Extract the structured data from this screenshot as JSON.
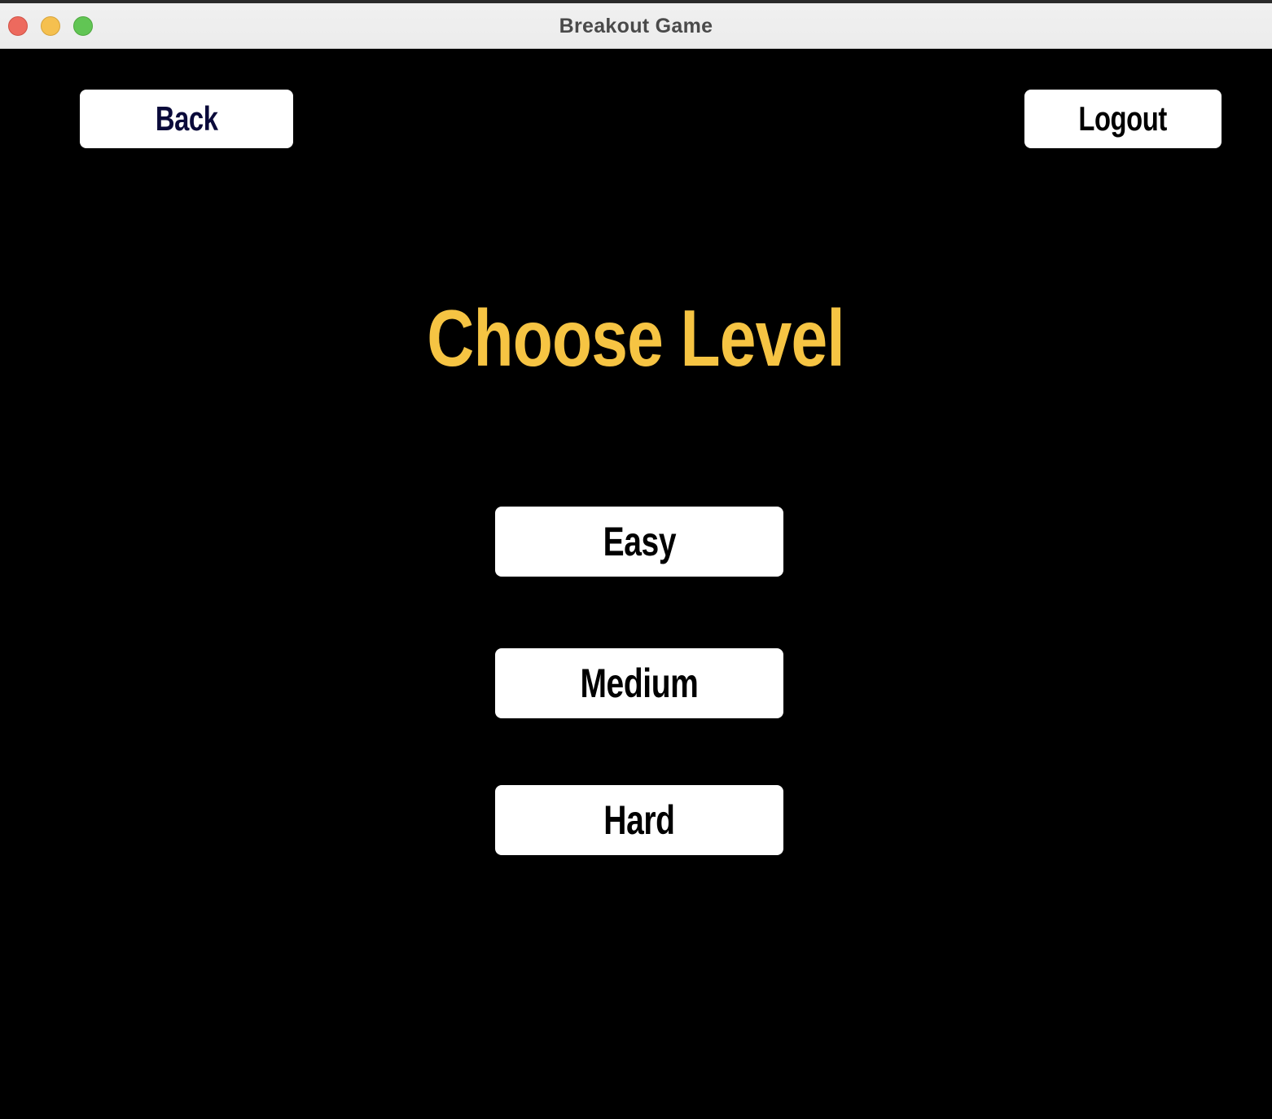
{
  "window": {
    "title": "Breakout Game"
  },
  "toolbar": {
    "back_label": "Back",
    "logout_label": "Logout"
  },
  "main": {
    "heading": "Choose Level",
    "levels": [
      {
        "label": "Easy"
      },
      {
        "label": "Medium"
      },
      {
        "label": "Hard"
      }
    ]
  },
  "colors": {
    "background": "#000000",
    "heading": "#f6c443",
    "button_bg": "#ffffff",
    "back_text": "#0a0a3a",
    "button_text": "#000000"
  }
}
